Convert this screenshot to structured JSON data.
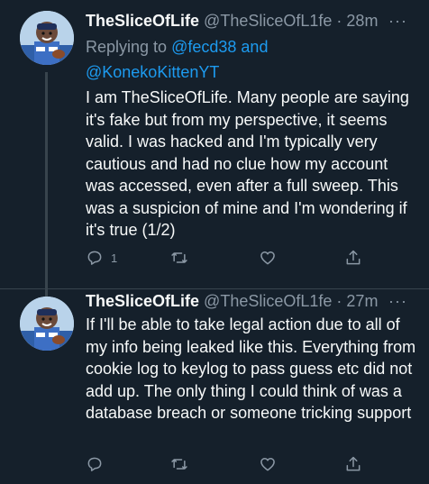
{
  "tweets": [
    {
      "display_name": "TheSliceOfLife",
      "handle": "@TheSliceOfL1fe",
      "separator": "·",
      "time": "28m",
      "more_label": "···",
      "replying_prefix": "Replying to",
      "mention_1": "@fecd38",
      "conjunction": "and",
      "mention_2": "@KonekoKittenYT",
      "text": "I am TheSliceOfLife. Many people are saying it's fake but from my perspective, it seems valid. I was hacked and I'm typically very cautious and had no clue how my account was accessed, even after a full sweep. This was a suspicion of mine and I'm wondering if it's true (1/2)",
      "reply_count": "1"
    },
    {
      "display_name": "TheSliceOfLife",
      "handle": "@TheSliceOfL1fe",
      "separator": "·",
      "time": "27m",
      "more_label": "···",
      "text": "If I'll be able to take legal action due to all of my info being leaked like this. Everything from cookie log to keylog to pass guess etc did not add up. The only thing I could think of was a database breach or someone tricking support"
    }
  ],
  "icons": {
    "reply": "reply-icon",
    "retweet": "retweet-icon",
    "like": "like-icon",
    "share": "share-icon",
    "more": "more-icon"
  },
  "colors": {
    "background": "#15202b",
    "text": "#f7f9f9",
    "secondary": "#8b98a5",
    "link": "#1d9bf0",
    "divider": "#38444d"
  }
}
